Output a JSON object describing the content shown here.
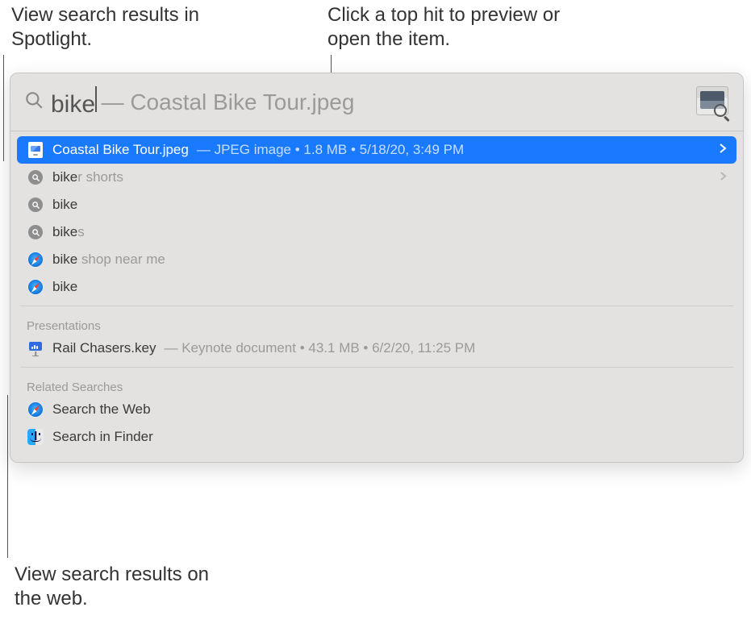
{
  "callouts": {
    "top_left": "View search results in Spotlight.",
    "top_right": "Click a top hit to preview or open the item.",
    "bottom": "View search results on the web."
  },
  "search": {
    "query": "bike",
    "completion_suffix": "— Coastal Bike Tour.jpeg",
    "app_icon": "preview-app-icon"
  },
  "top_hit": {
    "filename": "Coastal Bike Tour.jpeg",
    "meta": "— JPEG image • 1.8 MB • 5/18/20, 3:49 PM"
  },
  "suggestions": [
    {
      "match": "bike",
      "rest": "r shorts",
      "has_chevron": true
    },
    {
      "match": "bike",
      "rest": "",
      "has_chevron": false
    },
    {
      "match": "bike",
      "rest": "s",
      "has_chevron": false
    }
  ],
  "web_suggestions": [
    {
      "match": "bike",
      "rest": " shop near me"
    },
    {
      "match": "bike",
      "rest": ""
    }
  ],
  "sections": {
    "presentations": {
      "header": "Presentations",
      "items": [
        {
          "filename": "Rail Chasers.key",
          "meta": "— Keynote document • 43.1 MB • 6/2/20, 11:25 PM"
        }
      ]
    },
    "related": {
      "header": "Related Searches",
      "items": [
        {
          "label": "Search the Web",
          "icon": "safari"
        },
        {
          "label": "Search in Finder",
          "icon": "finder"
        }
      ]
    }
  }
}
